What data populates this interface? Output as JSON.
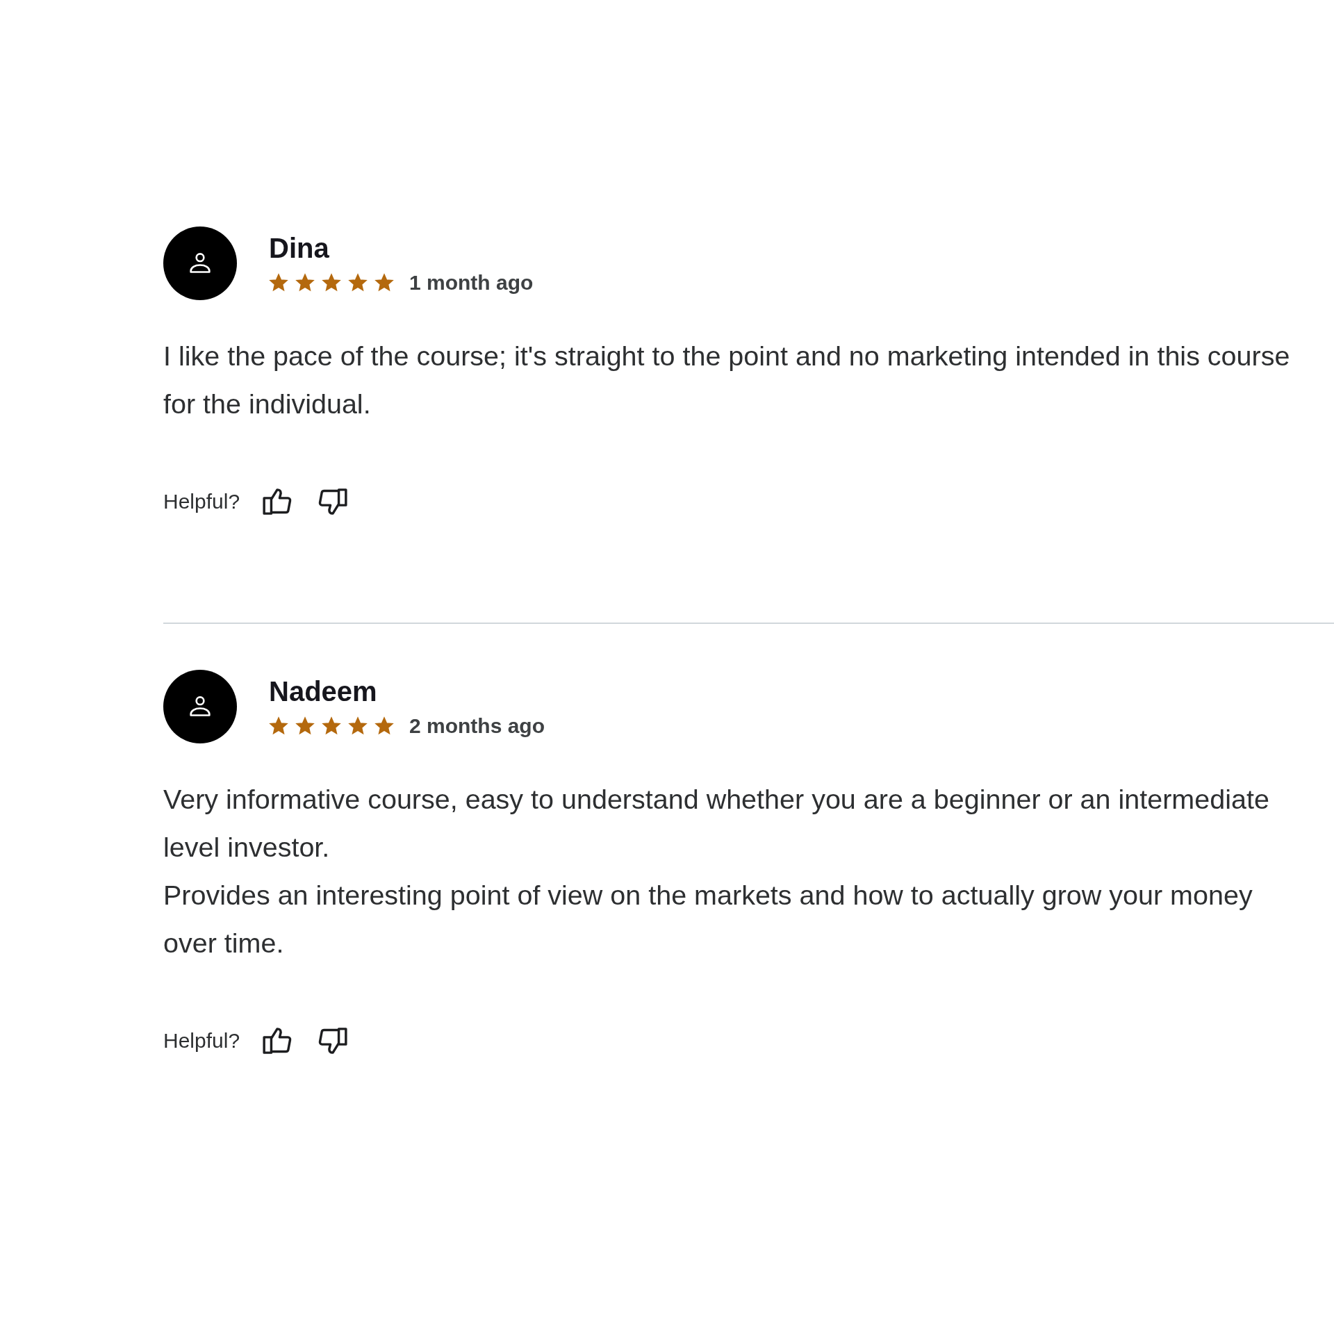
{
  "reviews": [
    {
      "name": "Dina",
      "stars": 5,
      "date": "1 month ago",
      "paragraphs": [
        "I like the pace of the course; it's straight to the point and no marketing intended in this course for the individual."
      ],
      "helpful_label": "Helpful?"
    },
    {
      "name": "Nadeem",
      "stars": 5,
      "date": "2 months ago",
      "paragraphs": [
        "Very informative course, easy to understand whether you are a beginner or an intermediate level investor.",
        "Provides an interesting point of view on the markets and how to actually grow your money over time."
      ],
      "helpful_label": "Helpful?"
    }
  ]
}
